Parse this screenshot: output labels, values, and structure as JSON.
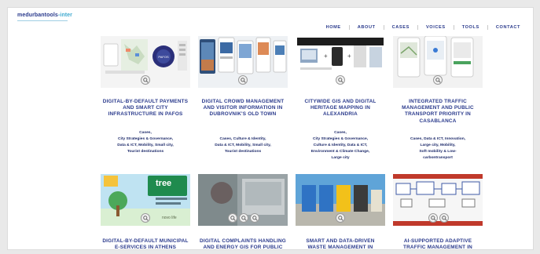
{
  "header": {
    "logo_main": "medurbantools",
    "logo_accent": "-inter"
  },
  "nav": [
    "HOME",
    "ABOUT",
    "CASES",
    "VOICES",
    "TOOLS",
    "CONTACT"
  ],
  "cards": [
    {
      "title": "DIGITAL-BY-DEFAULT PAYMENTS AND SMART CITY INFRASTRUCTURE IN PAFOS",
      "tags": [
        "Cases,",
        "City Strategies & Governance,",
        "Data & ICT, Mobility, Small city,",
        "Tourist destinations"
      ]
    },
    {
      "title": "DIGITAL CROWD MANAGEMENT AND VISITOR INFORMATION IN DUBROVNIK'S OLD TOWN",
      "tags": [
        "Cases, Culture & Identity,",
        "Data & ICT, Mobility, Small city,",
        "Tourist destinations"
      ]
    },
    {
      "title": "CITYWIDE GIS AND DIGITAL HERITAGE MAPPING IN ALEXANDRIA",
      "tags": [
        "Cases,",
        "City Strategies & Governance,",
        "Culture & Identity, Data & ICT,",
        "Environment & Climate Change,",
        "Large city"
      ]
    },
    {
      "title": "INTEGRATED TRAFFIC MANAGEMENT AND PUBLIC TRANSPORT PRIORITY IN CASABLANCA",
      "tags": [
        "Cases, Data & ICT, Innovation,",
        "Large city, Mobility,",
        "Soft mobility & Low-",
        "carbontransport"
      ]
    },
    {
      "title": "DIGITAL-BY-DEFAULT MUNICIPAL E-SERVICES IN ATHENS",
      "tags": [],
      "thumb_text": "tree",
      "thumb_sub": "novo life"
    },
    {
      "title": "DIGITAL COMPLAINTS HANDLING AND ENERGY GIS FOR PUBLIC LIGHTING IN",
      "tags": []
    },
    {
      "title": "SMART AND DATA-DRIVEN WASTE MANAGEMENT IN METROPOLE NICE CÔTE",
      "tags": []
    },
    {
      "title": "AI-SUPPORTED ADAPTIVE TRAFFIC MANAGEMENT IN ISTANBUL",
      "tags": []
    }
  ],
  "colors": {
    "brand": "#2a3a8c",
    "accent": "#3ea9cf"
  }
}
